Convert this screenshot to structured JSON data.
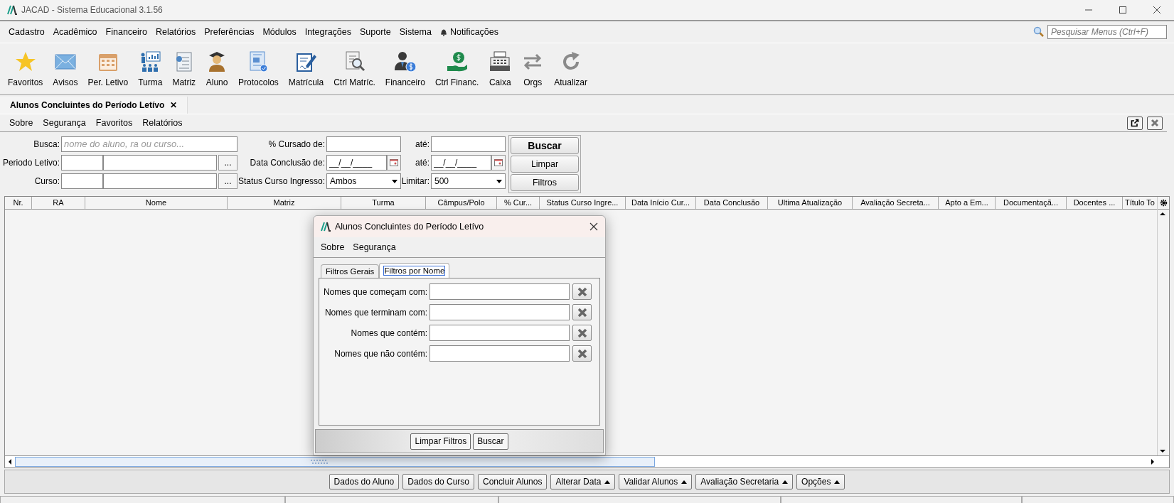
{
  "window": {
    "title": "JACAD - Sistema Educacional 3.1.56"
  },
  "menu": [
    "Cadastro",
    "Acadêmico",
    "Financeiro",
    "Relatórios",
    "Preferências",
    "Módulos",
    "Integrações",
    "Suporte",
    "Sistema",
    "Notificações"
  ],
  "menu_search": {
    "placeholder": "Pesquisar Menus (Ctrl+F)"
  },
  "toolbar": [
    {
      "label": "Favoritos"
    },
    {
      "label": "Avisos"
    },
    {
      "label": "Per. Letivo"
    },
    {
      "label": "Turma"
    },
    {
      "label": "Matriz"
    },
    {
      "label": "Aluno"
    },
    {
      "label": "Protocolos"
    },
    {
      "label": "Matrícula"
    },
    {
      "label": "Ctrl Matríc."
    },
    {
      "label": "Financeiro"
    },
    {
      "label": "Ctrl Financ."
    },
    {
      "label": "Caixa"
    },
    {
      "label": "Orgs"
    },
    {
      "label": "Atualizar"
    }
  ],
  "document_tab": {
    "title": "Alunos Concluintes do Período Letívo",
    "close": "✕"
  },
  "submenu": [
    "Sobre",
    "Segurança",
    "Favoritos",
    "Relatórios"
  ],
  "filters": {
    "busca": {
      "label": "Busca:",
      "placeholder": "nome do aluno, ra ou curso..."
    },
    "periodo_letivo": {
      "label": "Periodo Letivo:",
      "button": "..."
    },
    "curso": {
      "label": "Curso:",
      "button": "..."
    },
    "cursado_de": {
      "label": "% Cursado de:"
    },
    "cursado_ate": {
      "label": "até:"
    },
    "conclusao_de": {
      "label": "Data Conclusão de:",
      "value": "__/__/____"
    },
    "conclusao_ate": {
      "label": "até:",
      "value": "__/__/____"
    },
    "status": {
      "label": "Status Curso Ingresso:",
      "value": "Ambos"
    },
    "limitar": {
      "label": "Limitar:",
      "value": "500"
    },
    "buttons": [
      "Buscar",
      "Limpar",
      "Filtros"
    ]
  },
  "table": {
    "columns": [
      "Nr.",
      "RA",
      "Nome",
      "Matriz",
      "Turma",
      "Câmpus/Polo",
      "% Cur...",
      "Status Curso Ingre...",
      "Data Início Cur...",
      "Data Conclusão",
      "Ultima Atualização",
      "Avaliação Secreta...",
      "Apto a Em...",
      "Documentaçã...",
      "Docentes ...",
      "Título To"
    ]
  },
  "dialog": {
    "title": "Alunos Concluintes do Período Letívo",
    "menu": [
      "Sobre",
      "Segurança"
    ],
    "tabs": [
      {
        "label": "Filtros Gerais",
        "selected": false
      },
      {
        "label": "Filtros por Nome",
        "selected": true
      }
    ],
    "fields": [
      {
        "label": "Nomes que começam com:"
      },
      {
        "label": "Nomes que terminam com:"
      },
      {
        "label": "Nomes que contém:"
      },
      {
        "label": "Nomes que não contém:"
      }
    ],
    "buttons": [
      "Limpar Filtros",
      "Buscar"
    ]
  },
  "actions": [
    {
      "label": "Dados do Aluno",
      "menu": false
    },
    {
      "label": "Dados do Curso",
      "menu": false
    },
    {
      "label": "Concluir Alunos",
      "menu": false
    },
    {
      "label": "Alterar Data",
      "menu": true
    },
    {
      "label": "Validar Alunos",
      "menu": true
    },
    {
      "label": "Avaliação Secretaria",
      "menu": true
    },
    {
      "label": "Opções",
      "menu": true
    }
  ]
}
